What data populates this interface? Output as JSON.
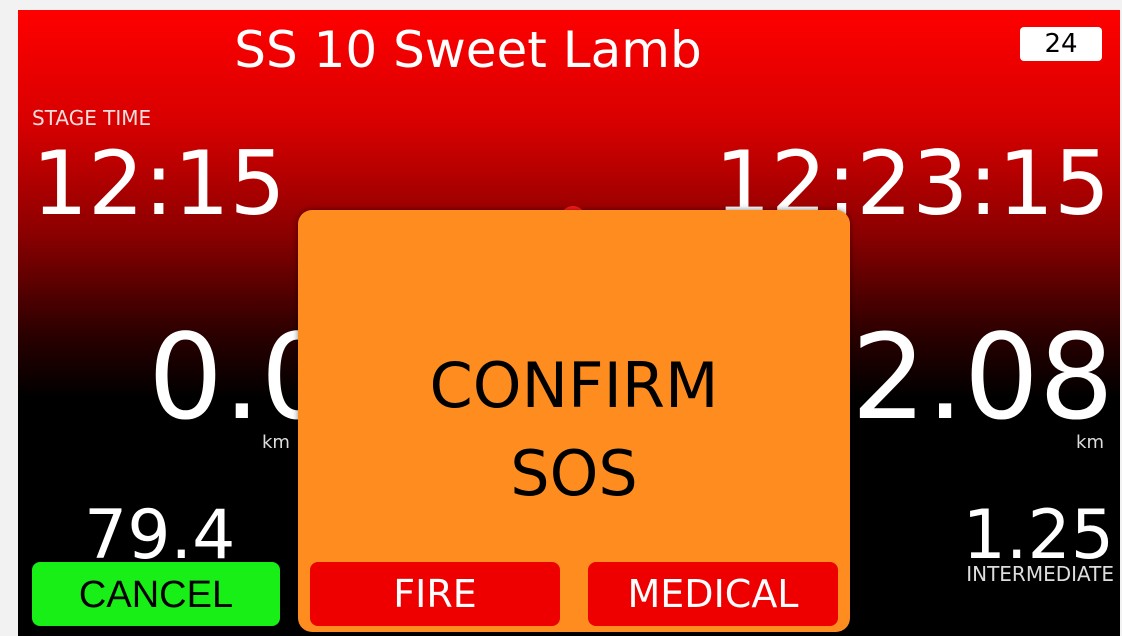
{
  "header": {
    "title": "SS 10   Sweet Lamb",
    "badge": "24"
  },
  "stage": {
    "label": "STAGE TIME",
    "time": "12:15",
    "clock": "12:23:15"
  },
  "distance": {
    "left_value": "0.0",
    "left_unit": "km",
    "right_value": "2.08",
    "right_unit": "km"
  },
  "speed": {
    "value": "79.4"
  },
  "intermediate": {
    "value": "1.25",
    "label": "INTERMEDIATE"
  },
  "buttons": {
    "cancel": "CANCEL"
  },
  "dialog": {
    "line1": "CONFIRM",
    "line2": "SOS",
    "fire": "FIRE",
    "medical": "MEDICAL"
  },
  "colors": {
    "header_red": "#ff0000",
    "dialog_orange": "#ff8c1f",
    "button_red": "#ee0000",
    "cancel_green": "#17ef17"
  }
}
